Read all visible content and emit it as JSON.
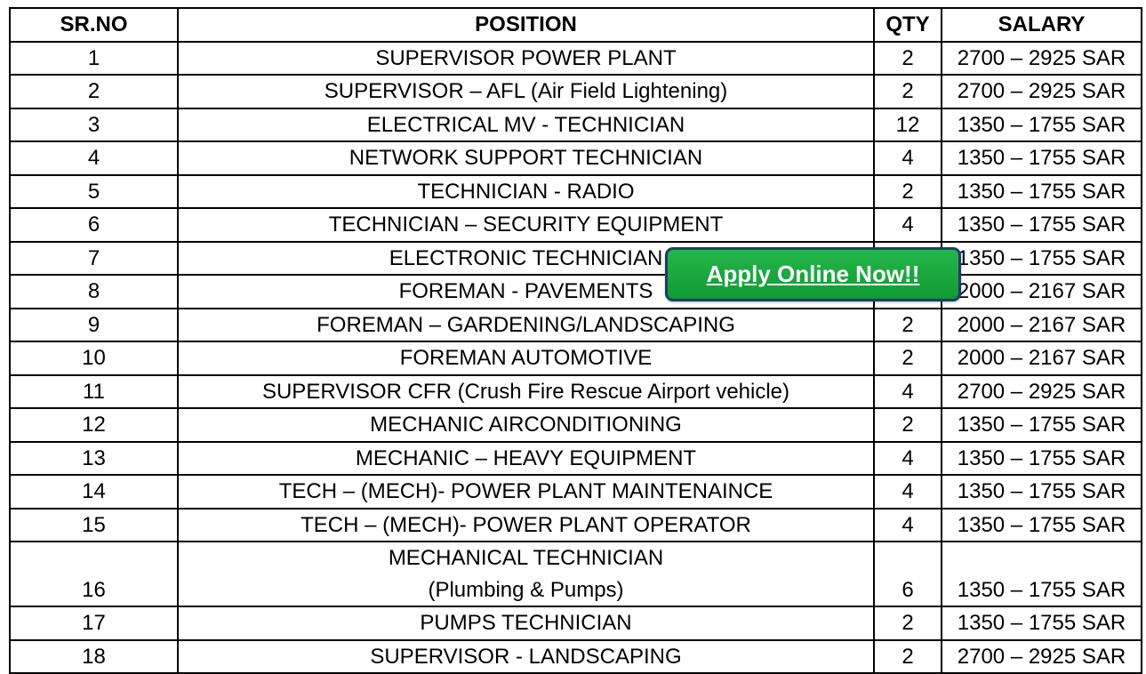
{
  "table": {
    "headers": {
      "sr_no": "SR.NO",
      "position": "POSITION",
      "qty": "QTY",
      "salary": "SALARY"
    },
    "rows": [
      {
        "sr": "1",
        "position": "SUPERVISOR POWER PLANT",
        "qty": "2",
        "salary": "2700 – 2925 SAR"
      },
      {
        "sr": "2",
        "position": "SUPERVISOR – AFL (Air Field Lightening)",
        "qty": "2",
        "salary": "2700 – 2925 SAR"
      },
      {
        "sr": "3",
        "position": "ELECTRICAL MV - TECHNICIAN",
        "qty": "12",
        "salary": "1350 – 1755 SAR"
      },
      {
        "sr": "4",
        "position": "NETWORK SUPPORT TECHNICIAN",
        "qty": "4",
        "salary": "1350 – 1755 SAR"
      },
      {
        "sr": "5",
        "position": "TECHNICIAN - RADIO",
        "qty": "2",
        "salary": "1350 – 1755 SAR"
      },
      {
        "sr": "6",
        "position": "TECHNICIAN – SECURITY EQUIPMENT",
        "qty": "4",
        "salary": "1350 – 1755 SAR"
      },
      {
        "sr": "7",
        "position": "ELECTRONIC TECHNICIAN",
        "qty": "",
        "salary": "1350 – 1755 SAR"
      },
      {
        "sr": "8",
        "position": "FOREMAN - PAVEMENTS",
        "qty": "",
        "salary": "2000 – 2167 SAR"
      },
      {
        "sr": "9",
        "position": "FOREMAN – GARDENING/LANDSCAPING",
        "qty": "2",
        "salary": "2000 – 2167 SAR"
      },
      {
        "sr": "10",
        "position": "FOREMAN AUTOMOTIVE",
        "qty": "2",
        "salary": "2000 – 2167 SAR"
      },
      {
        "sr": "11",
        "position": "SUPERVISOR CFR (Crush Fire Rescue Airport vehicle)",
        "qty": "4",
        "salary": "2700 – 2925 SAR"
      },
      {
        "sr": "12",
        "position": "MECHANIC AIRCONDITIONING",
        "qty": "2",
        "salary": "1350 – 1755 SAR"
      },
      {
        "sr": "13",
        "position": "MECHANIC – HEAVY EQUIPMENT",
        "qty": "4",
        "salary": "1350 – 1755 SAR"
      },
      {
        "sr": "14",
        "position": "TECH – (MECH)- POWER PLANT MAINTENAINCE",
        "qty": "4",
        "salary": "1350 – 1755 SAR"
      },
      {
        "sr": "15",
        "position": "TECH – (MECH)- POWER PLANT OPERATOR",
        "qty": "4",
        "salary": "1350 – 1755 SAR"
      },
      {
        "sr": "16",
        "position": "MECHANICAL TECHNICIAN",
        "position_line2": "(Plumbing & Pumps)",
        "qty": "6",
        "salary": "1350 – 1755 SAR"
      },
      {
        "sr": "17",
        "position": "PUMPS TECHNICIAN",
        "qty": "2",
        "salary": "1350 – 1755 SAR"
      },
      {
        "sr": "18",
        "position": "SUPERVISOR - LANDSCAPING",
        "qty": "2",
        "salary": "2700 – 2925 SAR"
      }
    ]
  },
  "apply_button": {
    "label": "Apply Online Now!!",
    "color": "#1aa83e",
    "border_color": "#1f3d6b"
  }
}
